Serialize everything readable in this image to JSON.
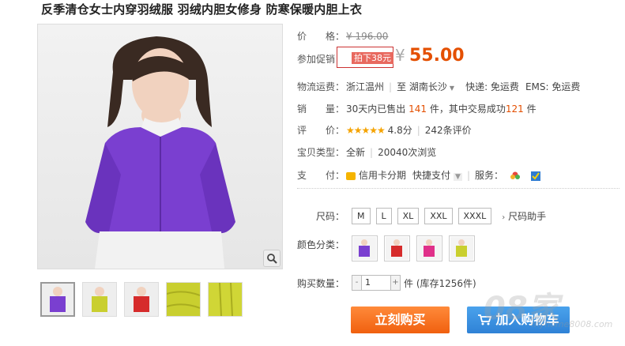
{
  "title": "反季清仓女士内穿羽绒服 羽绒内胆女修身 防寒保暖内胆上衣",
  "price": {
    "label": "价　　格：",
    "original": "¥ 196.00"
  },
  "promo": {
    "label": "参加促销：",
    "tag": "拍下38元",
    "yen": "¥",
    "amount": "55.00"
  },
  "shipping": {
    "label": "物流运费：",
    "from": "浙江温州",
    "to_prefix": "至",
    "to": "湖南长沙",
    "express": "快递: 免运费",
    "ems": "EMS: 免运费"
  },
  "sales": {
    "label": "销　　量：",
    "prefix": "30天内已售出",
    "count": "141",
    "mid": "件，其中交易成功",
    "success": "121",
    "suffix": "件"
  },
  "rating": {
    "label": "评　　价：",
    "stars": "★★★★★",
    "score": "4.8分",
    "reviews": "242条评价"
  },
  "type": {
    "label": "宝贝类型：",
    "value": "全新",
    "views": "20040次浏览"
  },
  "pay": {
    "label": "支　　付：",
    "credit": "信用卡分期",
    "quick": "快捷支付",
    "service_label": "服务："
  },
  "size": {
    "label": "尺码：",
    "options": [
      "M",
      "L",
      "XL",
      "XXL",
      "XXXL"
    ],
    "help": "尺码助手"
  },
  "color": {
    "label": "颜色分类：",
    "swatches": [
      "#7a3fd0",
      "#d62b2b",
      "#e0308a",
      "#c9cf2f"
    ]
  },
  "quantity": {
    "label": "购买数量：",
    "minus": "-",
    "value": "1",
    "plus": "+",
    "stock": "件 (库存1256件)"
  },
  "buttons": {
    "buy": "立刻购买",
    "cart": "加入购物车"
  },
  "watermark": {
    "brand": "08家",
    "url": "myhome8008.com"
  },
  "colors": {
    "accent": "#e44f00",
    "cart_blue": "#2f82d6",
    "jacket": "#7a3fd0"
  }
}
